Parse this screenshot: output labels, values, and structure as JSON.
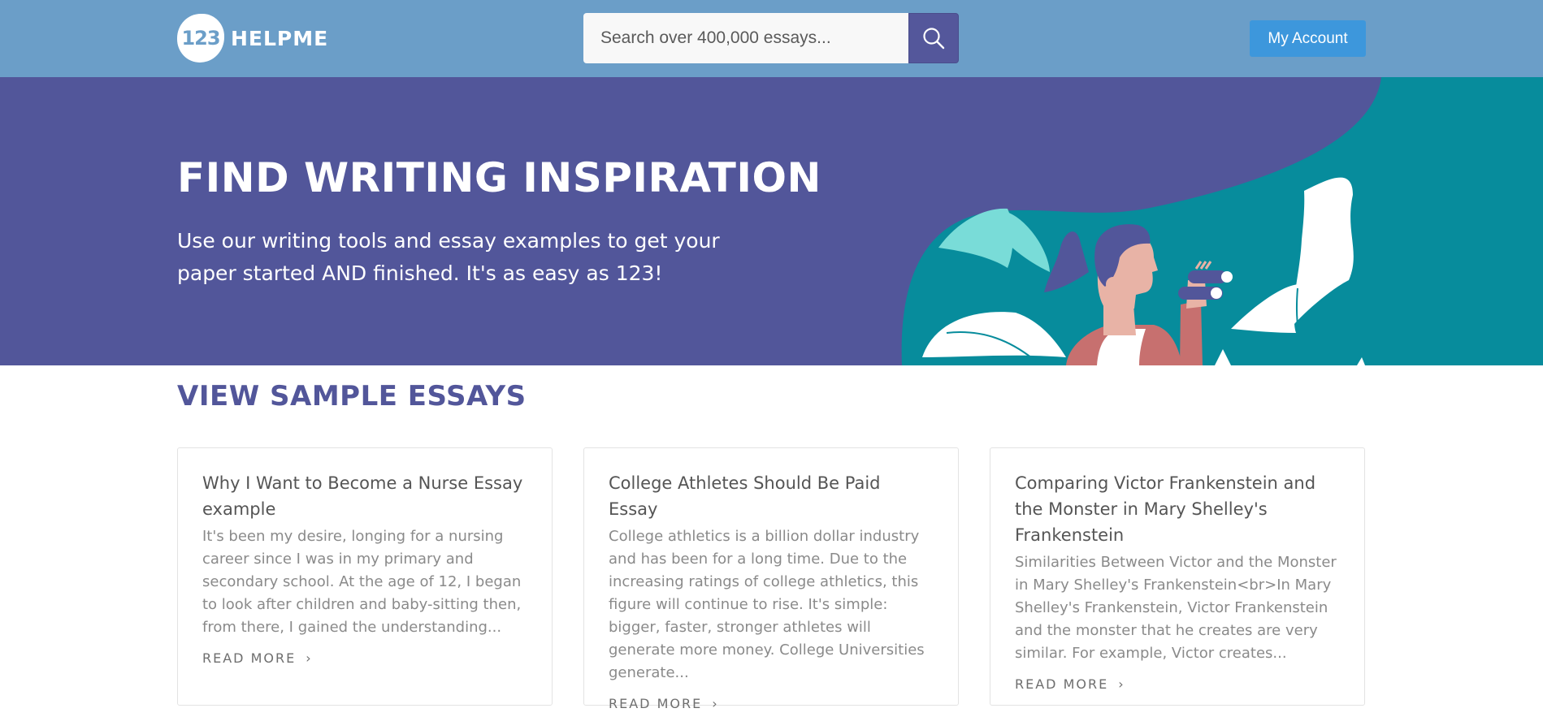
{
  "header": {
    "logo_badge": "123",
    "logo_text": "HELPME",
    "search_placeholder": "Search over 400,000 essays...",
    "search_icon": "search-icon",
    "account_label": "My Account"
  },
  "hero": {
    "title": "FIND WRITING INSPIRATION",
    "subtitle": "Use our writing tools and essay examples to get your paper started AND finished. It's as easy as 123!"
  },
  "section": {
    "title": "VIEW SAMPLE ESSAYS"
  },
  "cards": [
    {
      "title": "Why I Want to Become a Nurse Essay example",
      "excerpt": "It's been my desire, longing for a nursing career since I was in my primary and secondary school. At the age of 12, I began to look after children and baby-sitting then, from there, I gained the understanding...",
      "read_more": "READ MORE",
      "chevron": "›"
    },
    {
      "title": "College Athletes Should Be Paid Essay",
      "excerpt": "College athletics is a billion dollar industry and has been for a long time. Due to the increasing ratings of college athletics, this figure will continue to rise. It's simple: bigger, faster, stronger athletes will generate more money. College Universities generate...",
      "read_more": "READ MORE",
      "chevron": "›"
    },
    {
      "title": "Comparing Victor Frankenstein and the Monster in Mary Shelley's Frankenstein",
      "excerpt": "Similarities Between Victor and the Monster in Mary Shelley's Frankenstein<br>In Mary Shelley's Frankenstein, Victor Frankenstein and the monster that he creates are very similar. For example, Victor creates...",
      "read_more": "READ MORE",
      "chevron": "›"
    }
  ],
  "colors": {
    "header_bg": "#6b9ec8",
    "hero_bg": "#52569a",
    "hero_teal": "#078c9c",
    "accent_button": "#3d97dc",
    "section_title": "#52569a"
  }
}
